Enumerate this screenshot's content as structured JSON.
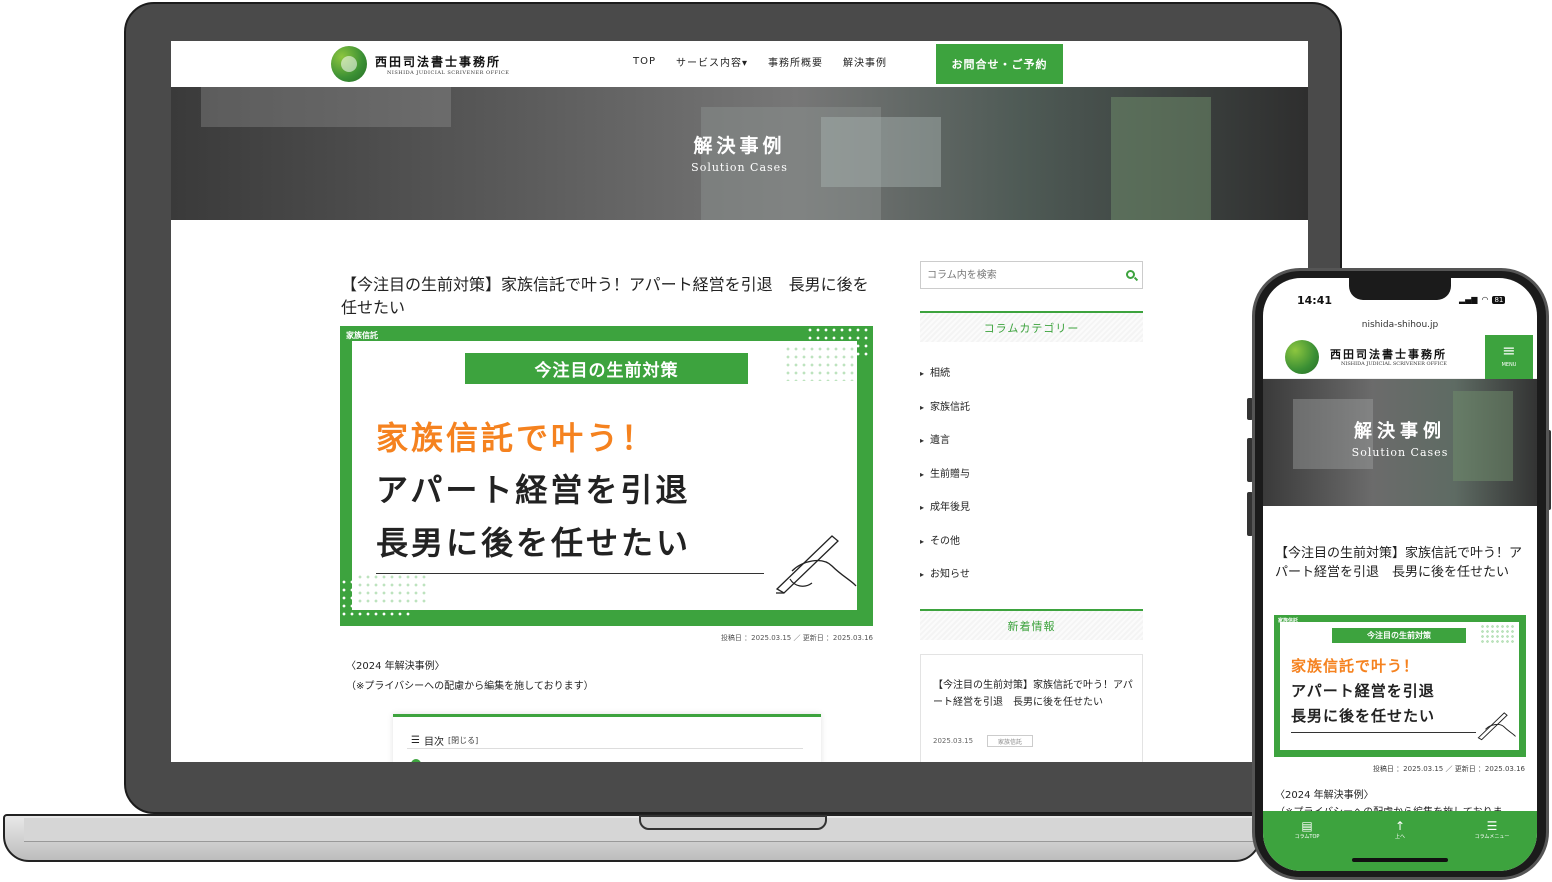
{
  "brand": {
    "name": "西田司法書士事務所",
    "name_en": "NISHIDA JUDICIAL SCRIVENER OFFICE",
    "accent_color": "#3da33e",
    "highlight_color": "#f5821f"
  },
  "nav": {
    "items": [
      "TOP",
      "サービス内容▾",
      "事務所概要",
      "解決事例"
    ],
    "cta": "お問合せ・ご予約"
  },
  "hero": {
    "title": "解決事例",
    "subtitle": "Solution Cases"
  },
  "article": {
    "title": "【今注目の生前対策】家族信託で叶う！アパート経営を引退　長男に後を任せたい",
    "eyecatch": {
      "tag": "家族信託",
      "band": "今注目の生前対策",
      "line1": "家族信託で叶う！",
      "line2": "アパート経営を引退",
      "line3": "長男に後を任せたい"
    },
    "meta": "投稿日 ：2025.03.15 ／ 更新日 ：2025.03.16",
    "intro1": "〈2024 年解決事例〉",
    "intro2": "（※プライバシーへの配慮から編集を施しております）",
    "toc_label": "目次",
    "toc_toggle": "[閉じる]",
    "toc_icon": "list-icon"
  },
  "sidebar": {
    "search_placeholder": "コラム内を検索",
    "search_icon": "search-icon",
    "categories_heading": "コラムカテゴリー",
    "categories": [
      "相続",
      "家族信託",
      "遺言",
      "生前贈与",
      "成年後見",
      "その他",
      "お知らせ"
    ],
    "new_heading": "新着情報",
    "new_post": {
      "title": "【今注目の生前対策】家族信託で叶う！アパート経営を引退　長男に後を任せたい",
      "date": "2025.03.15",
      "tag": "家族信託"
    }
  },
  "phone": {
    "time": "14:41",
    "battery": "81",
    "url": "nishida-shihou.jp",
    "menu_label": "MENU",
    "meta": "投稿日 ：2025.03.15 ／ 更新日 ：2025.03.16",
    "intro2": "（※プライバシーへの配慮から編集を施しておりま",
    "bottom_nav": [
      {
        "icon": "book-icon",
        "label": "コラムTOP"
      },
      {
        "icon": "arrow-up-icon",
        "label": "上へ"
      },
      {
        "icon": "menu-list-icon",
        "label": "コラムメニュー"
      }
    ]
  }
}
